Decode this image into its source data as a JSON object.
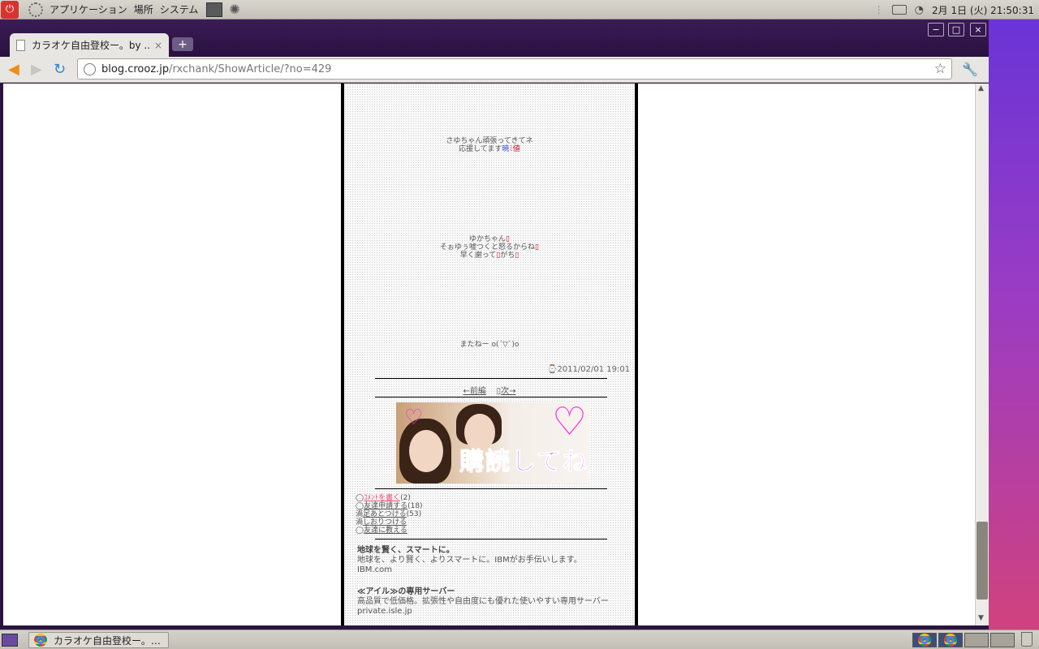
{
  "top_panel": {
    "menu": [
      "アプリケーション",
      "場所",
      "システム"
    ],
    "clock": "2月 1日 (火) 21:50:31"
  },
  "browser": {
    "tab_title": "カラオケ自由登校ー。by ...",
    "tab_close": "×",
    "new_tab": "+",
    "url_host": "blog.crooz.jp",
    "url_path": "/rxchank/ShowArticle/?no=429",
    "controls": {
      "minimize": "−",
      "maximize": "□",
      "close": "×"
    }
  },
  "article": {
    "lines_a": [
      {
        "text": "さゆちゃん頑張ってきてネ"
      },
      {
        "pre": "応援してます",
        "colored": [
          {
            "t": "暁",
            "c": "blue"
          },
          {
            "t": "ﾐ",
            "c": "pink"
          },
          {
            "t": "値",
            "c": "red"
          }
        ]
      }
    ],
    "lines_b": [
      "ゆかちゃん",
      "そぉゆぅ嘘つくと怒るからね",
      "早く謝って",
      "がち"
    ],
    "bye": "またねー o(´▽`)o",
    "date": "2011/02/01 19:01",
    "prev": "←前編",
    "next": "次→",
    "photo_caption": "購読してね",
    "actions": [
      {
        "bullet": "◯",
        "label": "ｺﾒﾝﾄを書く",
        "count": "(2)",
        "pink": true
      },
      {
        "bullet": "◯",
        "label": "友達申請する",
        "count": "(18)"
      },
      {
        "bullet": "渦",
        "label": "足あとつける",
        "count": "(53)"
      },
      {
        "bullet": "渦",
        "label": "しおりつける",
        "count": ""
      },
      {
        "bullet": "◯",
        "label": "友達に教える",
        "count": ""
      }
    ],
    "ads": [
      {
        "title": "地球を賢く、スマートに。",
        "body": "地球を、より賢く、よりスマートに。IBMがお手伝いします。",
        "source": "IBM.com"
      },
      {
        "title": "≪アイル≫の専用サーバー",
        "body": "高品質で低価格。拡張性や自由度にも優れた使いやすい専用サーバー",
        "source": "private.isle.jp"
      }
    ]
  },
  "taskbar": {
    "task_label": "カラオケ自由登校ー。…"
  }
}
